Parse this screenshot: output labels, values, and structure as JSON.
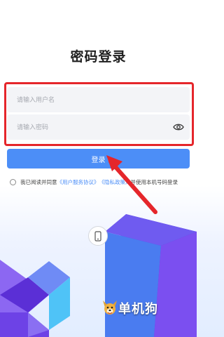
{
  "page": {
    "title": "密码登录"
  },
  "form": {
    "username_placeholder": "请输入用户名",
    "password_placeholder": "请输入密码",
    "login_label": "登录"
  },
  "agreement": {
    "prefix": "我已阅读并同意",
    "terms_link": "《用户服务协议》",
    "privacy_link": "《隐私政策》",
    "suffix": "并使用本机号码登录"
  },
  "other_login": {
    "icon": "phone-icon"
  },
  "watermark": {
    "text": "单机狗"
  },
  "colors": {
    "accent": "#4c8ef7",
    "highlight": "#e5262b",
    "decor_primary": "#6d42e6",
    "decor_secondary": "#4a7cf0"
  }
}
